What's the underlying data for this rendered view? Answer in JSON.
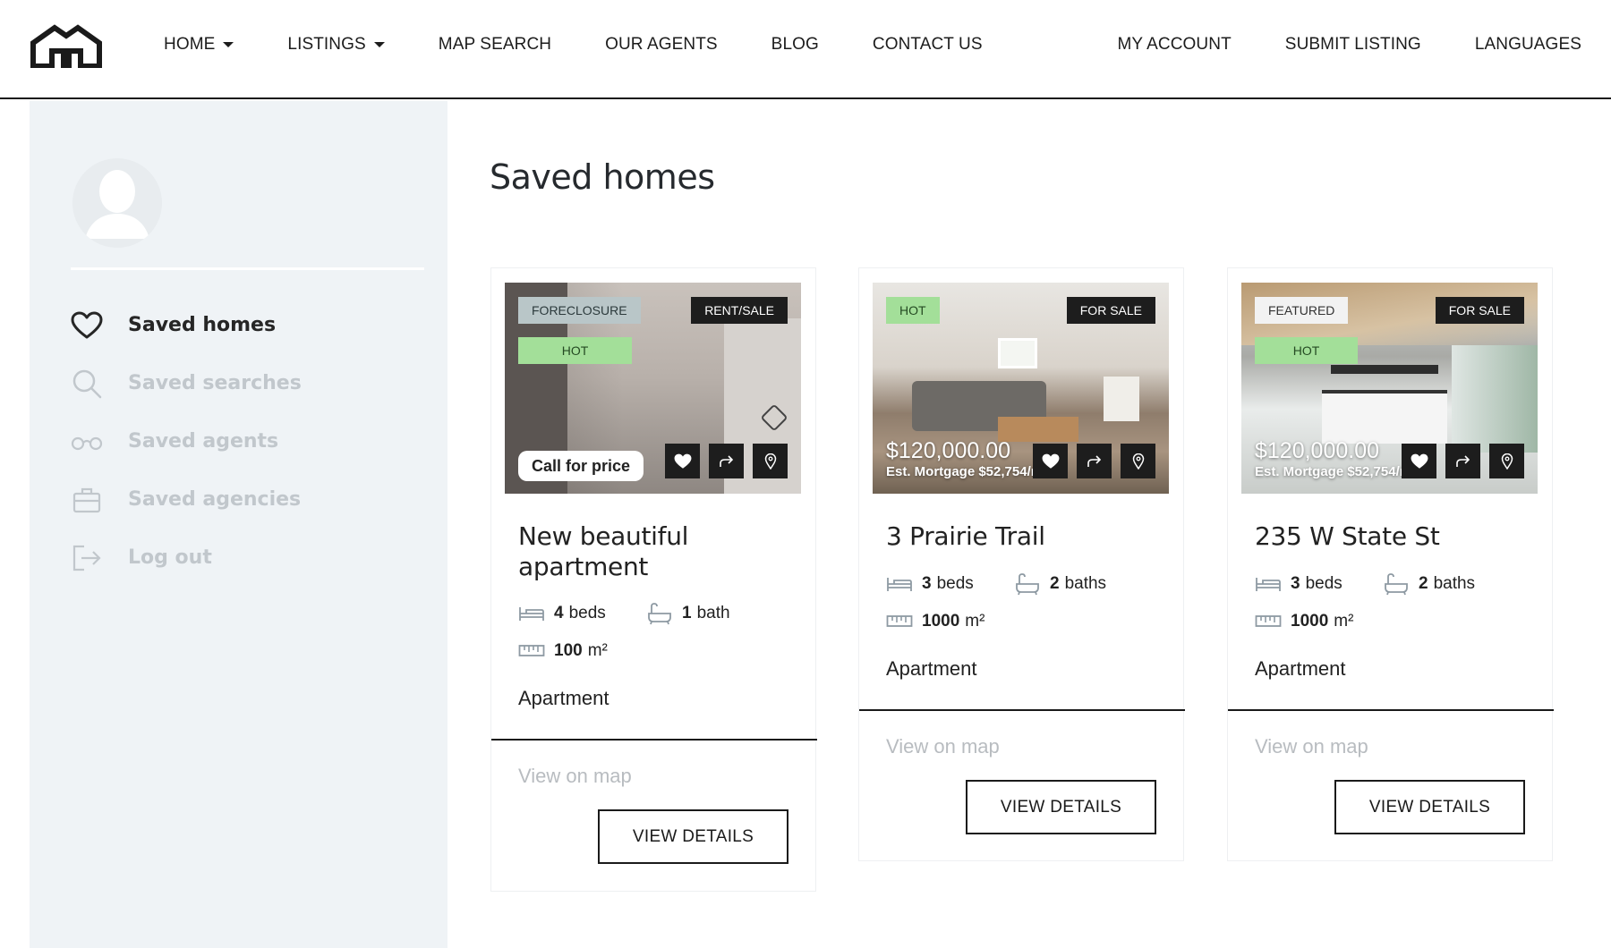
{
  "header": {
    "nav_left": [
      {
        "label": "HOME",
        "dropdown": true
      },
      {
        "label": "LISTINGS",
        "dropdown": true
      },
      {
        "label": "MAP SEARCH"
      },
      {
        "label": "OUR AGENTS"
      },
      {
        "label": "BLOG"
      },
      {
        "label": "CONTACT US"
      }
    ],
    "nav_right": [
      {
        "label": "MY ACCOUNT"
      },
      {
        "label": "SUBMIT LISTING"
      },
      {
        "label": "LANGUAGES"
      }
    ]
  },
  "sidebar": {
    "items": [
      {
        "label": "Saved homes",
        "icon": "heart-icon",
        "active": true
      },
      {
        "label": "Saved searches",
        "icon": "search-icon"
      },
      {
        "label": "Saved agents",
        "icon": "glasses-icon"
      },
      {
        "label": "Saved agencies",
        "icon": "briefcase-icon"
      },
      {
        "label": "Log out",
        "icon": "logout-icon"
      }
    ]
  },
  "main": {
    "title": "Saved homes",
    "cards": [
      {
        "badges_left": [
          {
            "text": "FORECLOSURE",
            "style": "gray"
          },
          {
            "text": "HOT",
            "style": "green"
          }
        ],
        "badge_right": "RENT/SALE",
        "price_pill": "Call for price",
        "title_lines": [
          "New beautiful",
          "apartment"
        ],
        "beds": "4",
        "beds_label": "beds",
        "baths": "1",
        "baths_label": "bath",
        "area": "100",
        "area_unit": "m²",
        "type": "Apartment",
        "view_on_map": "View on map",
        "view_details": "VIEW DETAILS"
      },
      {
        "badges_left": [
          {
            "text": "HOT",
            "style": "green"
          }
        ],
        "badge_right": "FOR SALE",
        "price": "$120,000.00",
        "mortgage": "Est. Mortgage $52,754/mo",
        "title_lines": [
          "3 Prairie Trail"
        ],
        "beds": "3",
        "beds_label": "beds",
        "baths": "2",
        "baths_label": "baths",
        "area": "1000",
        "area_unit": "m²",
        "type": "Apartment",
        "view_on_map": "View on map",
        "view_details": "VIEW DETAILS"
      },
      {
        "badges_left": [
          {
            "text": "FEATURED",
            "style": "white"
          },
          {
            "text": "HOT",
            "style": "green"
          }
        ],
        "badge_right": "FOR SALE",
        "price": "$120,000.00",
        "mortgage": "Est. Mortgage $52,754/mo",
        "title_lines": [
          "235 W State St"
        ],
        "beds": "3",
        "beds_label": "beds",
        "baths": "2",
        "baths_label": "baths",
        "area": "1000",
        "area_unit": "m²",
        "type": "Apartment",
        "view_on_map": "View on map",
        "view_details": "VIEW DETAILS"
      }
    ]
  },
  "colors": {
    "sidebar_bg": "#eff3f6",
    "badge_dark": "#1d1d1d",
    "badge_green": "#a3df99",
    "badge_gray": "#b9c6c8",
    "muted_text": "#c1c7cc"
  }
}
